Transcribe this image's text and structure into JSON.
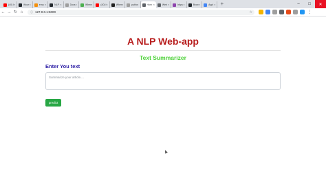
{
  "browser": {
    "tabs": [
      {
        "label": "(40) I",
        "color": "#ff0000"
      },
      {
        "label": "iflour",
        "color": "#24292e"
      },
      {
        "label": "ema",
        "color": "#f4900c"
      },
      {
        "label": "NLP",
        "color": "#24292e"
      },
      {
        "label": "Docs",
        "color": "#9e9e9e"
      },
      {
        "label": "When",
        "color": "#4caf50"
      },
      {
        "label": "(40) I",
        "color": "#ff0000"
      },
      {
        "label": "When",
        "color": "#212121"
      },
      {
        "label": "pytho",
        "color": "#9e9e9e"
      },
      {
        "label": "Hom",
        "color": "#ffffff",
        "active": true
      },
      {
        "label": "Web",
        "color": "#5f6368"
      },
      {
        "label": "https",
        "color": "#8e44ad"
      },
      {
        "label": "Brow",
        "color": "#24292e"
      },
      {
        "label": "Appl",
        "color": "#4285f4"
      }
    ],
    "new_tab": "+",
    "window_controls": {
      "minimize": "–",
      "maximize": "□",
      "close": "✕"
    },
    "url": "127.0.0.1:5000",
    "extension_colors": [
      "#f4b400",
      "#4285f4",
      "#9e9e9e",
      "#5f6368",
      "#e64a19",
      "#9e9e9e",
      "#2196f3"
    ]
  },
  "page": {
    "title": "A NLP Web-app",
    "subtitle": "Text Summarizer",
    "input_label": "Enter You text",
    "textarea_placeholder": "Summarize your article....",
    "predict_button": "predict"
  }
}
